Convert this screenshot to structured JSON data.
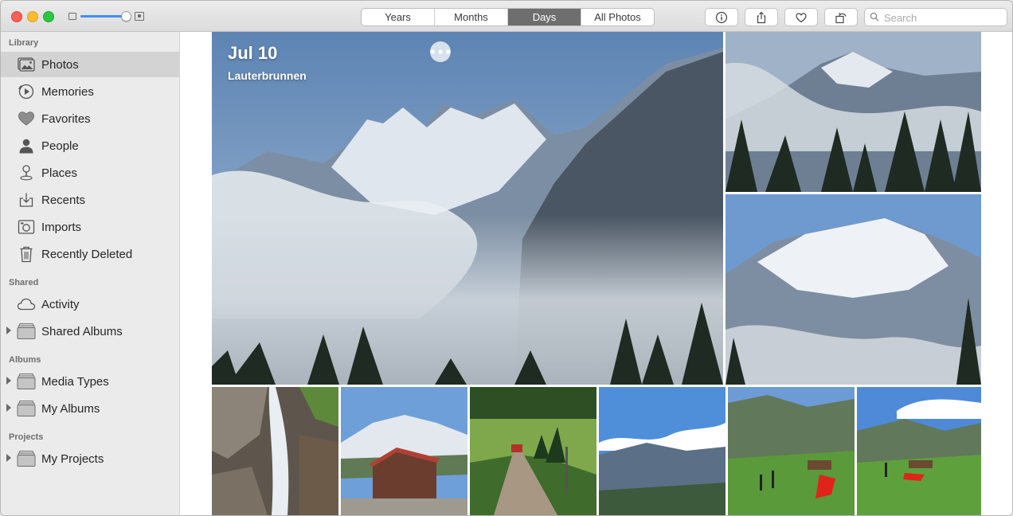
{
  "toolbar": {
    "segments": [
      "Years",
      "Months",
      "Days",
      "All Photos"
    ],
    "active_segment": "Days",
    "zoom_fraction": 0.95,
    "search_placeholder": "Search",
    "buttons": [
      "info-icon",
      "share-icon",
      "heart-icon",
      "rotate-icon"
    ]
  },
  "sidebar": {
    "library_title": "Library",
    "library": [
      {
        "label": "Photos",
        "icon": "photos-icon",
        "selected": true
      },
      {
        "label": "Memories",
        "icon": "memories-icon"
      },
      {
        "label": "Favorites",
        "icon": "heart-icon"
      },
      {
        "label": "People",
        "icon": "person-icon"
      },
      {
        "label": "Places",
        "icon": "pin-icon"
      },
      {
        "label": "Recents",
        "icon": "recents-icon"
      },
      {
        "label": "Imports",
        "icon": "camera-icon"
      },
      {
        "label": "Recently Deleted",
        "icon": "trash-icon"
      }
    ],
    "shared_title": "Shared",
    "shared": [
      {
        "label": "Activity",
        "icon": "cloud-icon"
      },
      {
        "label": "Shared Albums",
        "icon": "folder-icon"
      }
    ],
    "albums_title": "Albums",
    "albums": [
      {
        "label": "Media Types",
        "icon": "folder-icon"
      },
      {
        "label": "My Albums",
        "icon": "folder-icon"
      }
    ],
    "projects_title": "Projects",
    "projects": [
      {
        "label": "My Projects",
        "icon": "folder-icon"
      }
    ]
  },
  "main": {
    "day_title": "Jul 10",
    "day_location": "Lauterbrunnen",
    "more_icon": "ellipsis-icon"
  }
}
